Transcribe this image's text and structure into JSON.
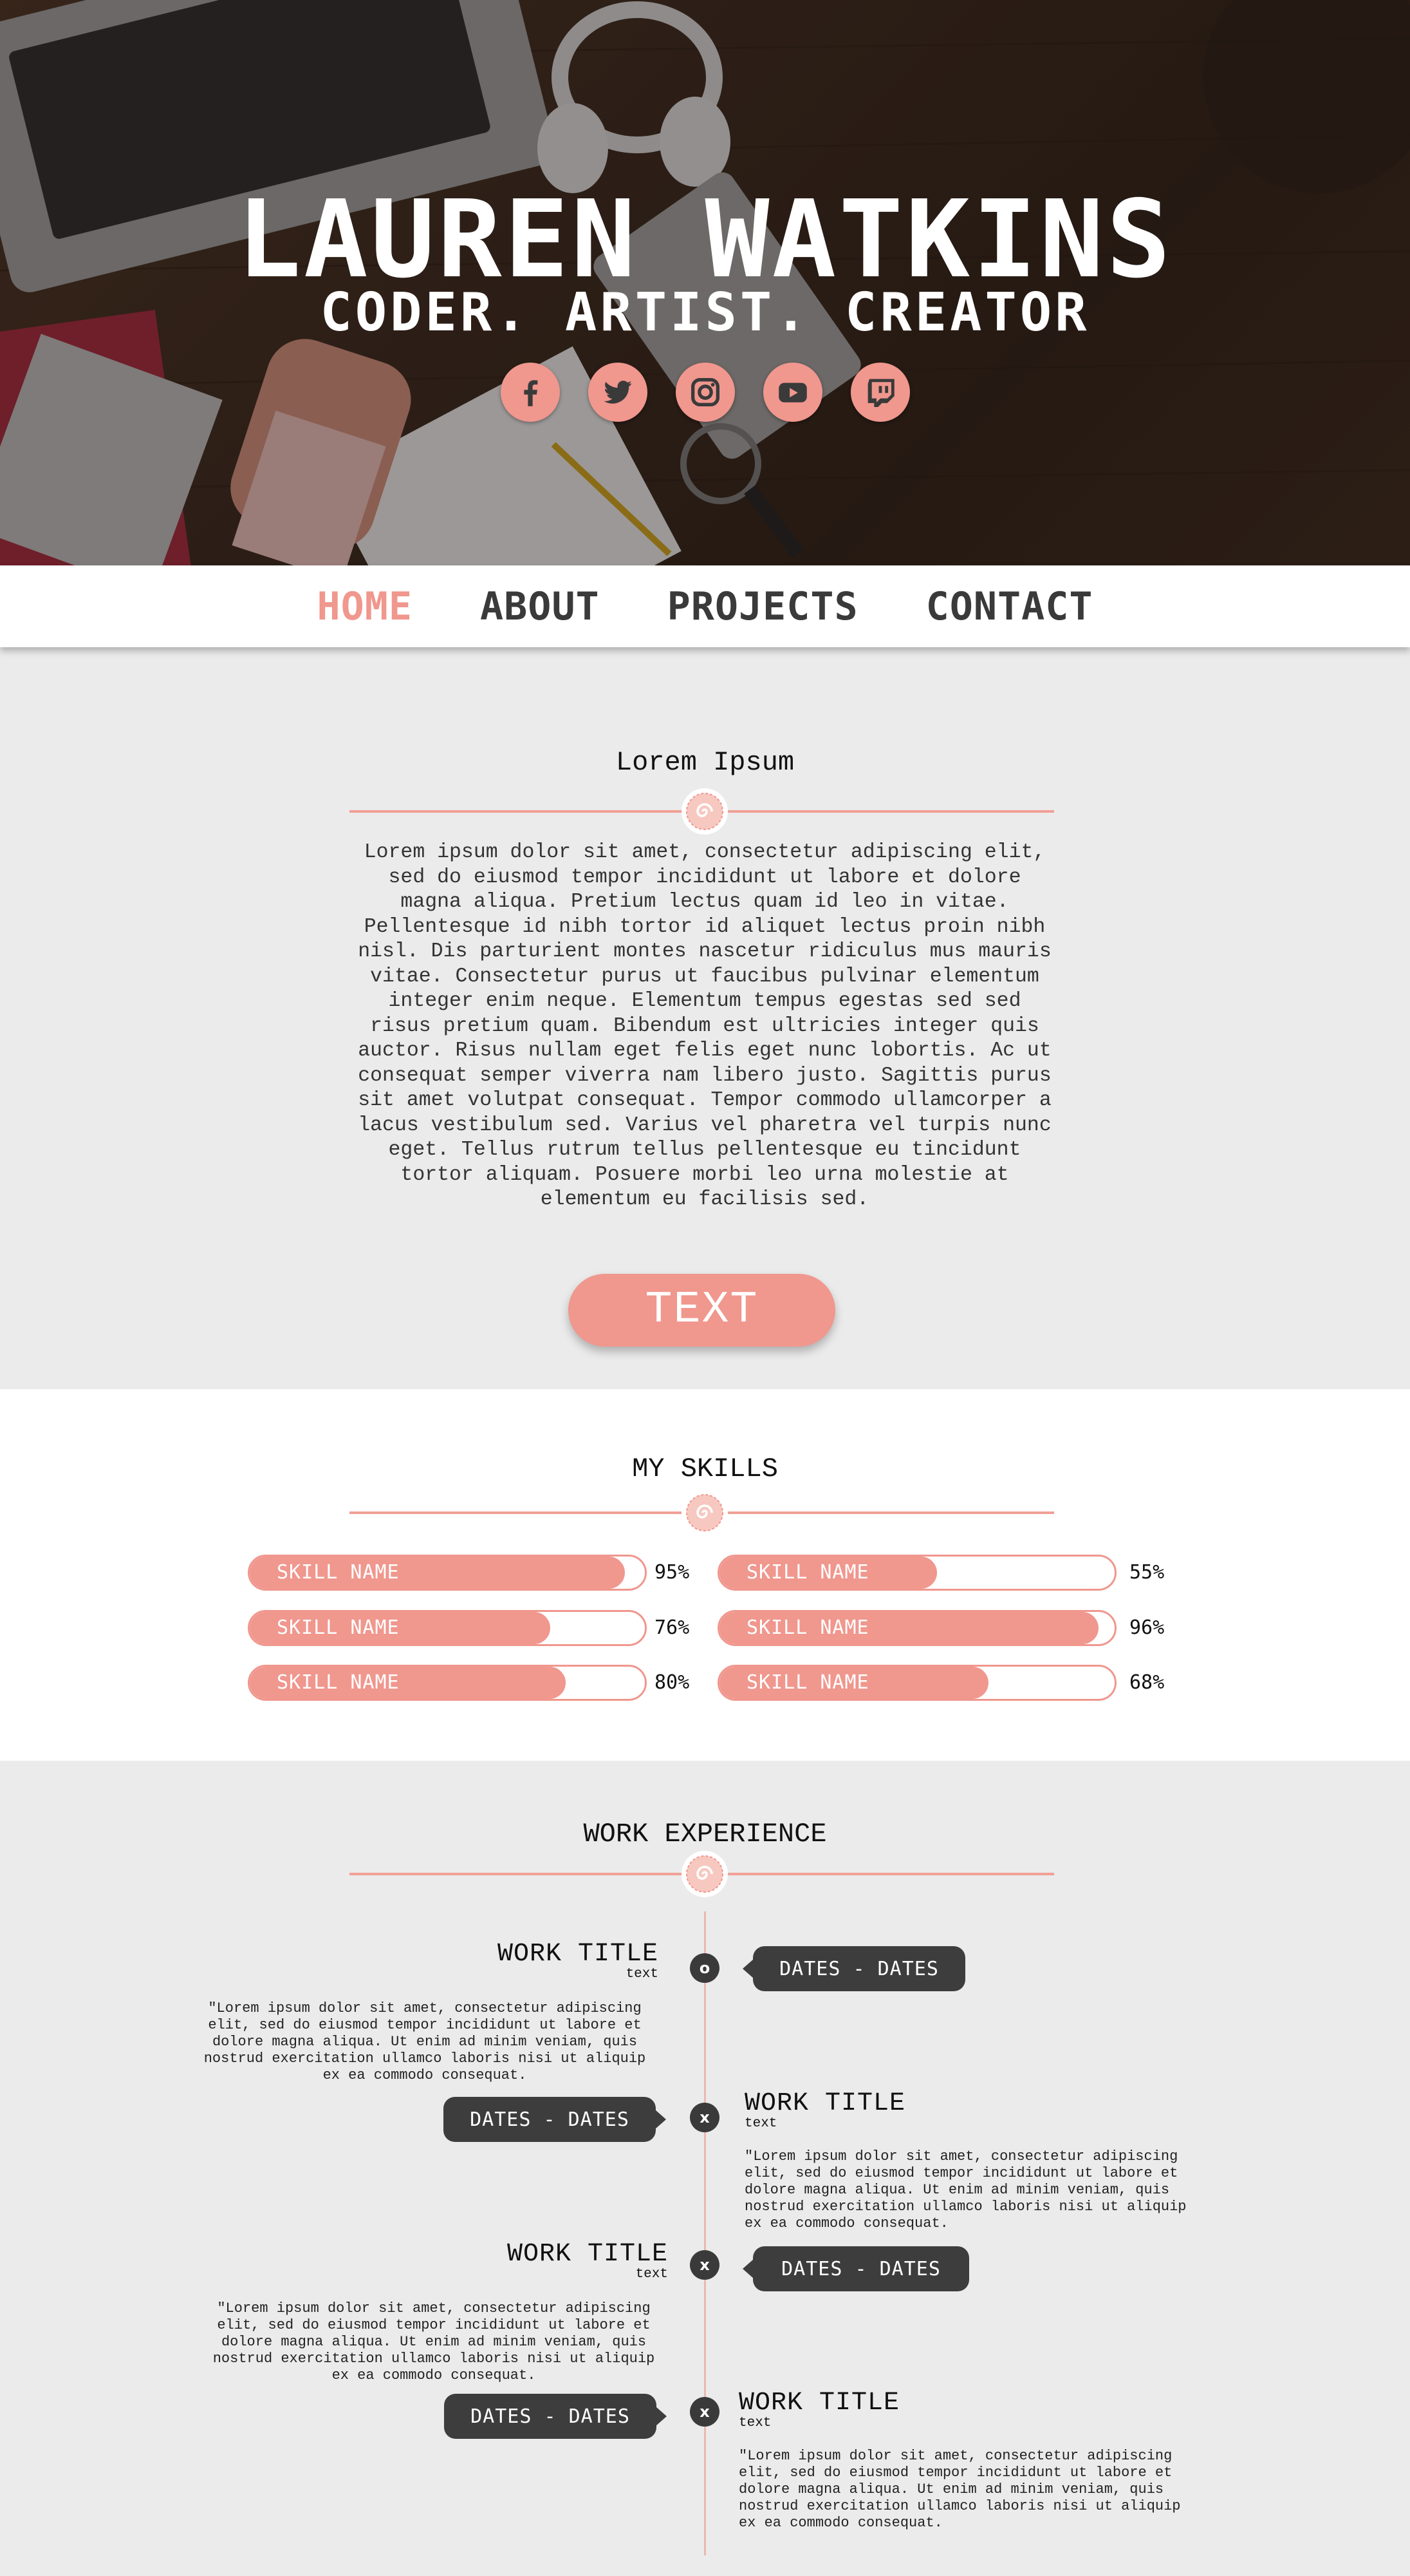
{
  "hero": {
    "name": "LAUREN WATKINS",
    "tagline": "CODER. ARTIST. CREATOR",
    "socials": [
      {
        "icon": "facebook-icon"
      },
      {
        "icon": "twitter-icon"
      },
      {
        "icon": "instagram-icon"
      },
      {
        "icon": "youtube-icon"
      },
      {
        "icon": "twitch-icon"
      }
    ]
  },
  "nav": {
    "items": [
      {
        "label": "HOME",
        "active": true
      },
      {
        "label": "ABOUT",
        "active": false
      },
      {
        "label": "PROJECTS",
        "active": false
      },
      {
        "label": "CONTACT",
        "active": false
      }
    ]
  },
  "intro": {
    "heading": "Lorem Ipsum",
    "paragraph": "Lorem ipsum dolor sit amet, consectetur adipiscing elit, sed do eiusmod tempor incididunt ut labore et dolore magna aliqua. Pretium lectus quam id leo in vitae. Pellentesque id nibh tortor id aliquet lectus proin nibh nisl. Dis parturient montes nascetur ridiculus mus mauris vitae. Consectetur purus ut faucibus pulvinar elementum integer enim neque. Elementum tempus egestas sed sed risus pretium quam. Bibendum est ultricies integer quis auctor. Risus nullam eget felis eget nunc lobortis. Ac ut consequat semper viverra nam libero justo. Sagittis purus sit amet volutpat consequat. Tempor commodo ullamcorper a lacus vestibulum sed. Varius vel pharetra vel turpis nunc eget. Tellus rutrum tellus pellentesque eu tincidunt tortor aliquam. Posuere morbi leo urna molestie at elementum eu facilisis sed.",
    "button_label": "TEXT"
  },
  "skills": {
    "heading": "MY SKILLS",
    "items": [
      {
        "name": "SKILL NAME",
        "percent": "95%",
        "level": 0.95
      },
      {
        "name": "SKILL NAME",
        "percent": "55%",
        "level": 0.55
      },
      {
        "name": "SKILL NAME",
        "percent": "76%",
        "level": 0.76
      },
      {
        "name": "SKILL NAME",
        "percent": "96%",
        "level": 0.96
      },
      {
        "name": "SKILL NAME",
        "percent": "80%",
        "level": 0.8
      },
      {
        "name": "SKILL NAME",
        "percent": "68%",
        "level": 0.68
      }
    ]
  },
  "work": {
    "heading": "WORK EXPERIENCE",
    "entries": [
      {
        "title": "WORK TITLE",
        "sub": "text",
        "dates": "DATES - DATES",
        "marker": "o",
        "description": "\"Lorem ipsum dolor sit amet, consectetur adipiscing elit, sed do eiusmod tempor incididunt ut labore et dolore magna aliqua. Ut enim ad minim veniam, quis nostrud exercitation ullamco laboris nisi ut aliquip ex ea commodo consequat."
      },
      {
        "title": "WORK TITLE",
        "sub": "text",
        "dates": "DATES - DATES",
        "marker": "x",
        "description": "\"Lorem ipsum dolor sit amet, consectetur adipiscing elit, sed do eiusmod tempor incididunt ut labore et dolore magna aliqua. Ut enim ad minim veniam, quis nostrud exercitation ullamco laboris nisi ut aliquip ex ea commodo consequat."
      },
      {
        "title": "WORK TITLE",
        "sub": "text",
        "dates": "DATES - DATES",
        "marker": "x",
        "description": "\"Lorem ipsum dolor sit amet, consectetur adipiscing elit, sed do eiusmod tempor incididunt ut labore et dolore magna aliqua. Ut enim ad minim veniam, quis nostrud exercitation ullamco laboris nisi ut aliquip ex ea commodo consequat."
      },
      {
        "title": "WORK TITLE",
        "sub": "text",
        "dates": "DATES - DATES",
        "marker": "x",
        "description": "\"Lorem ipsum dolor sit amet, consectetur adipiscing elit, sed do eiusmod tempor incididunt ut labore et dolore magna aliqua. Ut enim ad minim veniam, quis nostrud exercitation ullamco laboris nisi ut aliquip ex ea commodo consequat."
      }
    ]
  },
  "colors": {
    "accent": "#f0978e",
    "dark": "#3d3d3d",
    "background": "#ebebeb"
  }
}
